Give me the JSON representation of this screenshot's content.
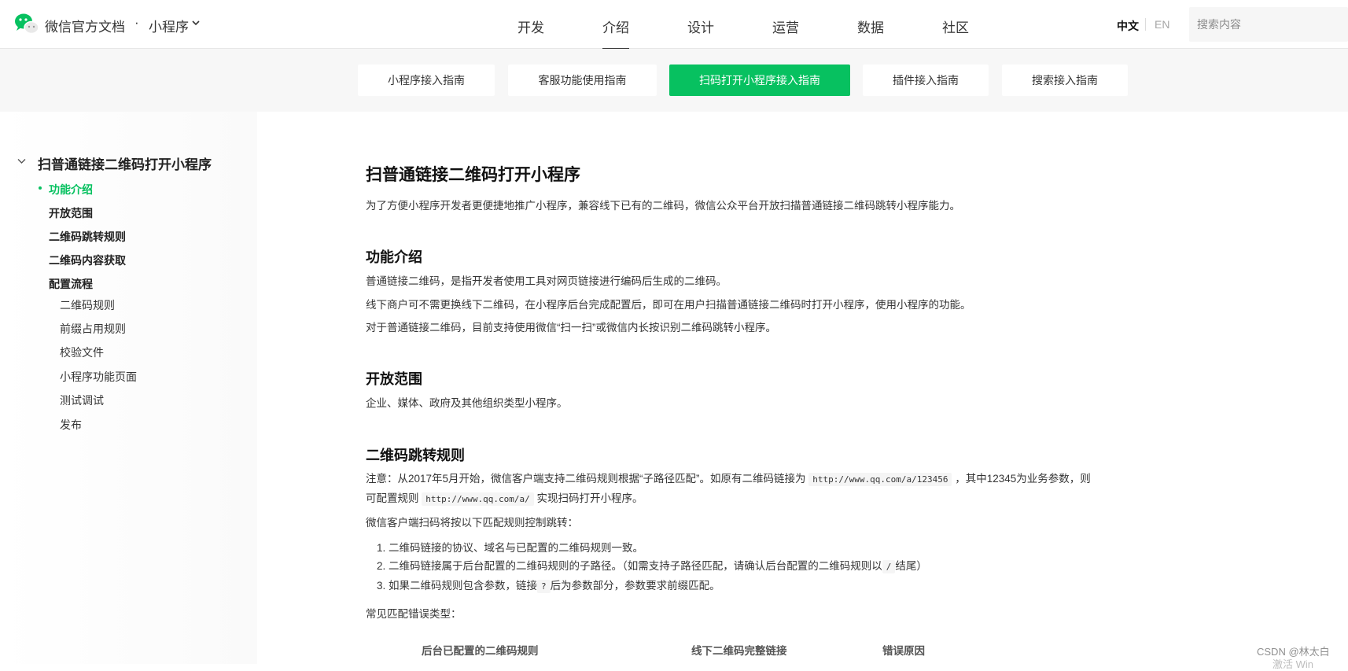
{
  "header": {
    "brand": "微信官方文档",
    "separator": "·",
    "product": "小程序",
    "nav": [
      "开发",
      "介绍",
      "设计",
      "运营",
      "数据",
      "社区"
    ],
    "active_nav": "介绍",
    "lang_zh": "中文",
    "lang_en": "EN",
    "search_placeholder": "搜索内容",
    "brand_color": "#07c160"
  },
  "subnav": {
    "tabs": [
      "小程序接入指南",
      "客服功能使用指南",
      "扫码打开小程序接入指南",
      "插件接入指南",
      "搜索接入指南"
    ],
    "active_tab": "扫码打开小程序接入指南"
  },
  "sidebar": {
    "root": "扫普通链接二维码打开小程序",
    "items": [
      {
        "label": "功能介绍",
        "level": 1,
        "active": true
      },
      {
        "label": "开放范围",
        "level": 1
      },
      {
        "label": "二维码跳转规则",
        "level": 1
      },
      {
        "label": "二维码内容获取",
        "level": 1
      },
      {
        "label": "配置流程",
        "level": 1
      },
      {
        "label": "二维码规则",
        "level": 2
      },
      {
        "label": "前缀占用规则",
        "level": 2
      },
      {
        "label": "校验文件",
        "level": 2
      },
      {
        "label": "小程序功能页面",
        "level": 2
      },
      {
        "label": "测试调试",
        "level": 2
      },
      {
        "label": "发布",
        "level": 2
      }
    ]
  },
  "content": {
    "title": "扫普通链接二维码打开小程序",
    "intro": "为了方便小程序开发者更便捷地推广小程序，兼容线下已有的二维码，微信公众平台开放扫描普通链接二维码跳转小程序能力。",
    "s1_title": "功能介绍",
    "s1_p1": "普通链接二维码，是指开发者使用工具对网页链接进行编码后生成的二维码。",
    "s1_p2": "线下商户可不需更换线下二维码，在小程序后台完成配置后，即可在用户扫描普通链接二维码时打开小程序，使用小程序的功能。",
    "s1_p3": "对于普通链接二维码，目前支持使用微信“扫一扫”或微信内长按识别二维码跳转小程序。",
    "s2_title": "开放范围",
    "s2_p1": "企业、媒体、政府及其他组织类型小程序。",
    "s3_title": "二维码跳转规则",
    "s3_note_a": "注意：从2017年5月开始，微信客户端支持二维码规则根据“子路径匹配”。如原有二维码链接为",
    "s3_note_code1": "http://www.qq.com/a/123456",
    "s3_note_b": "，其中12345为业务参数，则",
    "s3_note_c": "可配置规则",
    "s3_note_code2": "http://www.qq.com/a/",
    "s3_note_d": "实现扫码打开小程序。",
    "s3_p2": "微信客户端扫码将按以下匹配规则控制跳转：",
    "rule1": "1. 二维码链接的协议、域名与已配置的二维码规则一致。",
    "rule2_a": "2. 二维码链接属于后台配置的二维码规则的子路径。（如需支持子路径匹配，请确认后台配置的二维码规则以",
    "rule2_code": "/",
    "rule2_b": "结尾）",
    "rule3_a": "3. 如果二维码规则包含参数，链接",
    "rule3_code": "?",
    "rule3_b": "后为参数部分，参数要求前缀匹配。",
    "s3_p3": "常见匹配错误类型：",
    "table_headers": [
      "后台已配置的二维码规则",
      "线下二维码完整链接",
      "错误原因"
    ]
  },
  "watermark": "CSDN @林太白",
  "watermark2": "激活 Win"
}
